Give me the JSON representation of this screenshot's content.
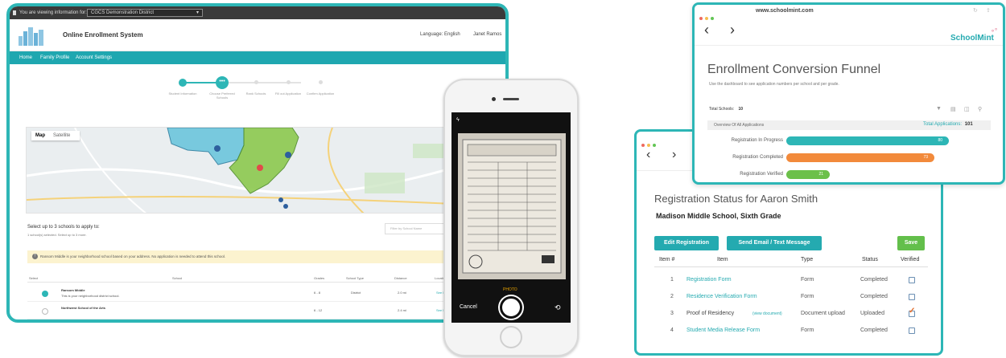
{
  "laptop": {
    "topbar": {
      "viewing_label": "You are viewing information for:",
      "district": "CGCS Demonstration District"
    },
    "header": {
      "title": "Online Enrollment System",
      "language": "Language: English",
      "user": "Janet Ramos"
    },
    "nav": [
      "Home",
      "Family Profile",
      "Account Settings"
    ],
    "steps": [
      "Student Information",
      "Choose Preferred Schools",
      "Rank Schools",
      "Fill out Application",
      "Confirm Application"
    ],
    "map": {
      "tabs": [
        "Map",
        "Satellite"
      ]
    },
    "select": {
      "title": "Select up to 3 schools to apply to:",
      "subtitle": "1 school(s) selected. Select up to 3 more."
    },
    "filter_placeholder": "Filter by School Name",
    "alert": "Ransom Middle is your neighborhood school based on your address. No application is needed to attend this school.",
    "table": {
      "headers": [
        "Select",
        "School",
        "Grades",
        "School Type",
        "Distance",
        "Location"
      ],
      "rows": [
        {
          "name": "Ransom Middle",
          "note": "This is your neighborhood district school.",
          "grades": "6 - 8",
          "type": "District",
          "distance": "2.0 mi",
          "link": "See Map"
        },
        {
          "name": "Northwest School of the Arts",
          "note": "",
          "grades": "6 - 12",
          "type": "",
          "distance": "2.4 mi",
          "link": "See Map"
        }
      ]
    }
  },
  "phone": {
    "mode_label": "PHOTO",
    "cancel_label": "Cancel"
  },
  "registration": {
    "title": "Registration Status for Aaron Smith",
    "subtitle": "Madison Middle School, Sixth Grade",
    "buttons": {
      "edit": "Edit Registration",
      "send": "Send Email / Text Message",
      "save": "Save"
    },
    "headers": [
      "Item #",
      "Item",
      "Type",
      "Status",
      "Verified"
    ],
    "rows": [
      {
        "num": "1",
        "item": "Registration Form",
        "extra": "",
        "type": "Form",
        "status": "Completed",
        "verified": false
      },
      {
        "num": "2",
        "item": "Residence Verification Form",
        "extra": "",
        "type": "Form",
        "status": "Completed",
        "verified": false
      },
      {
        "num": "3",
        "item": "Proof of Residency",
        "extra": "(view document)",
        "type": "Document upload",
        "status": "Uploaded",
        "verified": true
      },
      {
        "num": "4",
        "item": "Student Media Release Form",
        "extra": "",
        "type": "Form",
        "status": "Completed",
        "verified": false
      }
    ]
  },
  "funnel": {
    "url": "www.schoolmint.com",
    "brand": "SchoolMint",
    "title": "Enrollment Conversion Funnel",
    "description": "Use the dashboard to see application numbers per school and per grade.",
    "total_schools_label": "Total Schools:",
    "total_schools": "10",
    "overview_label": "Overview Of All Applications",
    "total_applications_label": "Total Applications:",
    "total_applications": "101",
    "bars": [
      {
        "label": "Registration In Progress",
        "value": "80",
        "color": "#2db6b6",
        "fraction": 0.79
      },
      {
        "label": "Registration Completed",
        "value": "73",
        "color": "#f28a3b",
        "fraction": 0.72
      },
      {
        "label": "Registration Verified",
        "value": "21",
        "color": "#6cc04a",
        "fraction": 0.21
      }
    ]
  }
}
